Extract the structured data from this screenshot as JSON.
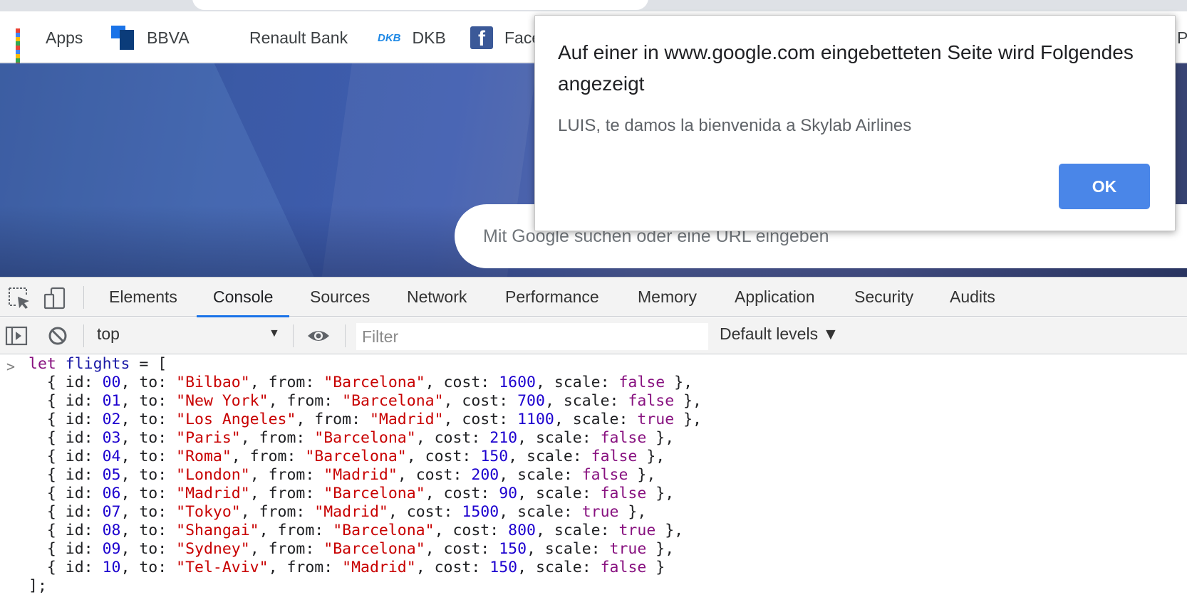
{
  "bookmarks": [
    {
      "label": "Apps",
      "icon": "apps-grid-icon"
    },
    {
      "label": "BBVA",
      "icon": "bbva-icon"
    },
    {
      "label": "Renault Bank",
      "icon": "renault-bank-icon"
    },
    {
      "label": "DKB",
      "icon": "dkb-icon",
      "icon_text": "DKB"
    },
    {
      "label": "Face",
      "icon": "facebook-icon",
      "icon_text": "f"
    },
    {
      "label": "P",
      "icon": ""
    }
  ],
  "ntp": {
    "search_placeholder": "Mit Google suchen oder eine URL eingeben"
  },
  "dialog": {
    "title": "Auf einer in www.google.com eingebetteten Seite wird Folgendes angezeigt",
    "message": "LUIS, te damos la bienvenida a Skylab Airlines",
    "ok_label": "OK"
  },
  "devtools": {
    "tabs": [
      "Elements",
      "Console",
      "Sources",
      "Network",
      "Performance",
      "Memory",
      "Application",
      "Security",
      "Audits"
    ],
    "active_tab": "Console",
    "context": "top",
    "filter_placeholder": "Filter",
    "levels": "Default levels ▼",
    "context_arrow": "▼",
    "prompt": ">"
  },
  "console": {
    "open_line": {
      "keyword": "let",
      "name": "flights",
      "rest": " = ["
    },
    "flights": [
      {
        "id": "00",
        "to": "Bilbao",
        "from": "Barcelona",
        "cost": "1600",
        "scale": "false",
        "comma": true
      },
      {
        "id": "01",
        "to": "New York",
        "from": "Barcelona",
        "cost": "700",
        "scale": "false",
        "comma": true
      },
      {
        "id": "02",
        "to": "Los Angeles",
        "from": "Madrid",
        "cost": "1100",
        "scale": "true",
        "comma": true
      },
      {
        "id": "03",
        "to": "Paris",
        "from": "Barcelona",
        "cost": "210",
        "scale": "false",
        "comma": true
      },
      {
        "id": "04",
        "to": "Roma",
        "from": "Barcelona",
        "cost": "150",
        "scale": "false",
        "comma": true
      },
      {
        "id": "05",
        "to": "London",
        "from": "Madrid",
        "cost": "200",
        "scale": "false",
        "comma": true
      },
      {
        "id": "06",
        "to": "Madrid",
        "from": "Barcelona",
        "cost": "90",
        "scale": "false",
        "comma": true
      },
      {
        "id": "07",
        "to": "Tokyo",
        "from": "Madrid",
        "cost": "1500",
        "scale": "true",
        "comma": true
      },
      {
        "id": "08",
        "to": "Shangai",
        "from": "Barcelona",
        "cost": "800",
        "scale": "true",
        "comma": true
      },
      {
        "id": "09",
        "to": "Sydney",
        "from": "Barcelona",
        "cost": "150",
        "scale": "true",
        "comma": true
      },
      {
        "id": "10",
        "to": "Tel-Aviv",
        "from": "Madrid",
        "cost": "150",
        "scale": "false",
        "comma": false
      }
    ],
    "close_line": "];"
  },
  "colors": {
    "accent": "#1a73e8",
    "ok_button": "#4a86e8",
    "string": "#c80000",
    "number": "#1c00cf",
    "keyword": "#881280"
  }
}
